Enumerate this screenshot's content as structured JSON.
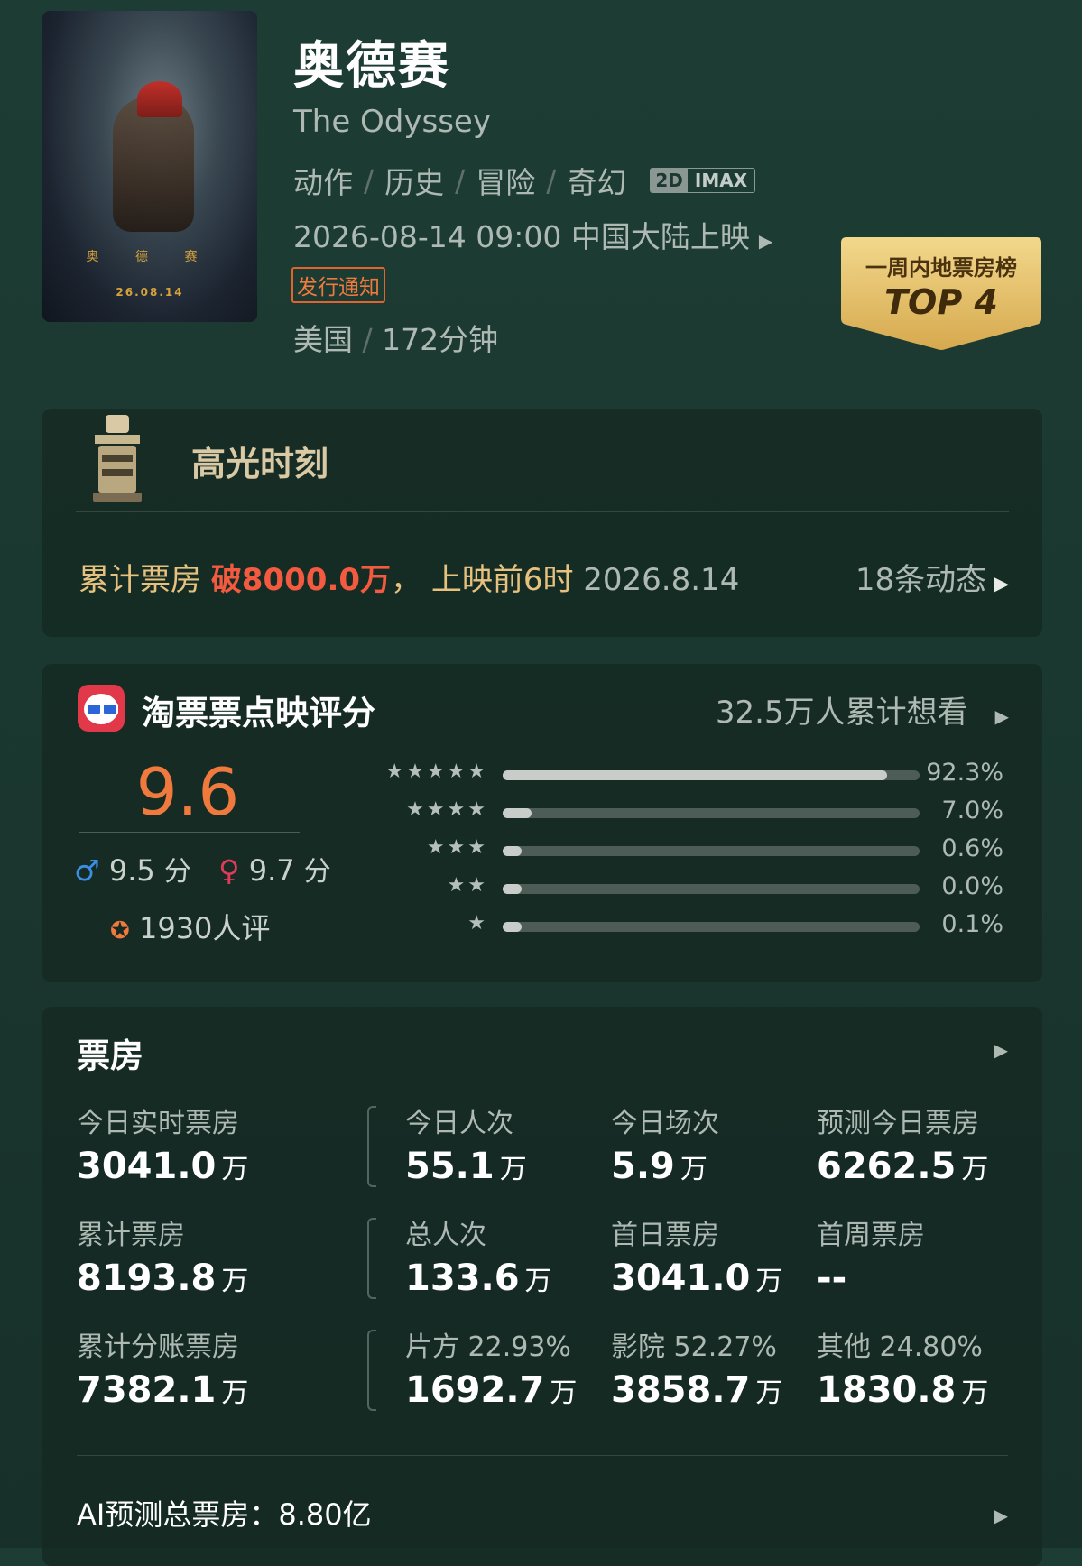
{
  "movie": {
    "poster_title": "奥 德 赛",
    "poster_date": "26.08.14",
    "title": "奥德赛",
    "english_title": "The Odyssey",
    "genres": [
      "动作",
      "历史",
      "冒险",
      "奇幻"
    ],
    "format_2d": "2D",
    "format_imax": "IMAX",
    "release": "2026-08-14 09:00 中国大陆上映",
    "notice": "发行通知",
    "country": "美国",
    "duration": "172分钟",
    "rank_badge": {
      "line1": "一周内地票房榜",
      "line2": "TOP 4"
    }
  },
  "highlight": {
    "title": "高光时刻",
    "label": "累计票房",
    "value": "破8000.0万",
    "comma": "，",
    "event": "上映前6时",
    "date": "2026.8.14",
    "updates": "18条动态"
  },
  "rating": {
    "title": "淘票票点映评分",
    "want": "32.5万人累计想看",
    "score": "9.6",
    "male_score": "9.5",
    "female_score": "9.7",
    "score_unit": "分",
    "reviews": "1930人评",
    "distribution": [
      {
        "stars": "★★★★★",
        "pct_label": "92.3%",
        "pct": 92.3
      },
      {
        "stars": "★★★★",
        "pct_label": "7.0%",
        "pct": 7.0
      },
      {
        "stars": "★★★",
        "pct_label": "0.6%",
        "pct": 0.6
      },
      {
        "stars": "★★",
        "pct_label": "0.0%",
        "pct": 0.0
      },
      {
        "stars": "★",
        "pct_label": "0.1%",
        "pct": 0.1
      }
    ]
  },
  "boxoffice": {
    "title": "票房",
    "unit": "万",
    "stats": [
      {
        "label": "今日实时票房",
        "value": "3041.0"
      },
      {
        "label": "今日人次",
        "value": "55.1"
      },
      {
        "label": "今日场次",
        "value": "5.9"
      },
      {
        "label": "预测今日票房",
        "value": "6262.5"
      },
      {
        "label": "累计票房",
        "value": "8193.8"
      },
      {
        "label": "总人次",
        "value": "133.6"
      },
      {
        "label": "首日票房",
        "value": "3041.0"
      },
      {
        "label": "首周票房",
        "value": "--"
      },
      {
        "label": "累计分账票房",
        "value": "7382.1"
      },
      {
        "label": "片方 22.93%",
        "value": "1692.7"
      },
      {
        "label": "影院 52.27%",
        "value": "3858.7"
      },
      {
        "label": "其他 24.80%",
        "value": "1830.8"
      }
    ],
    "ai_forecast": "AI预测总票房：8.80亿"
  }
}
